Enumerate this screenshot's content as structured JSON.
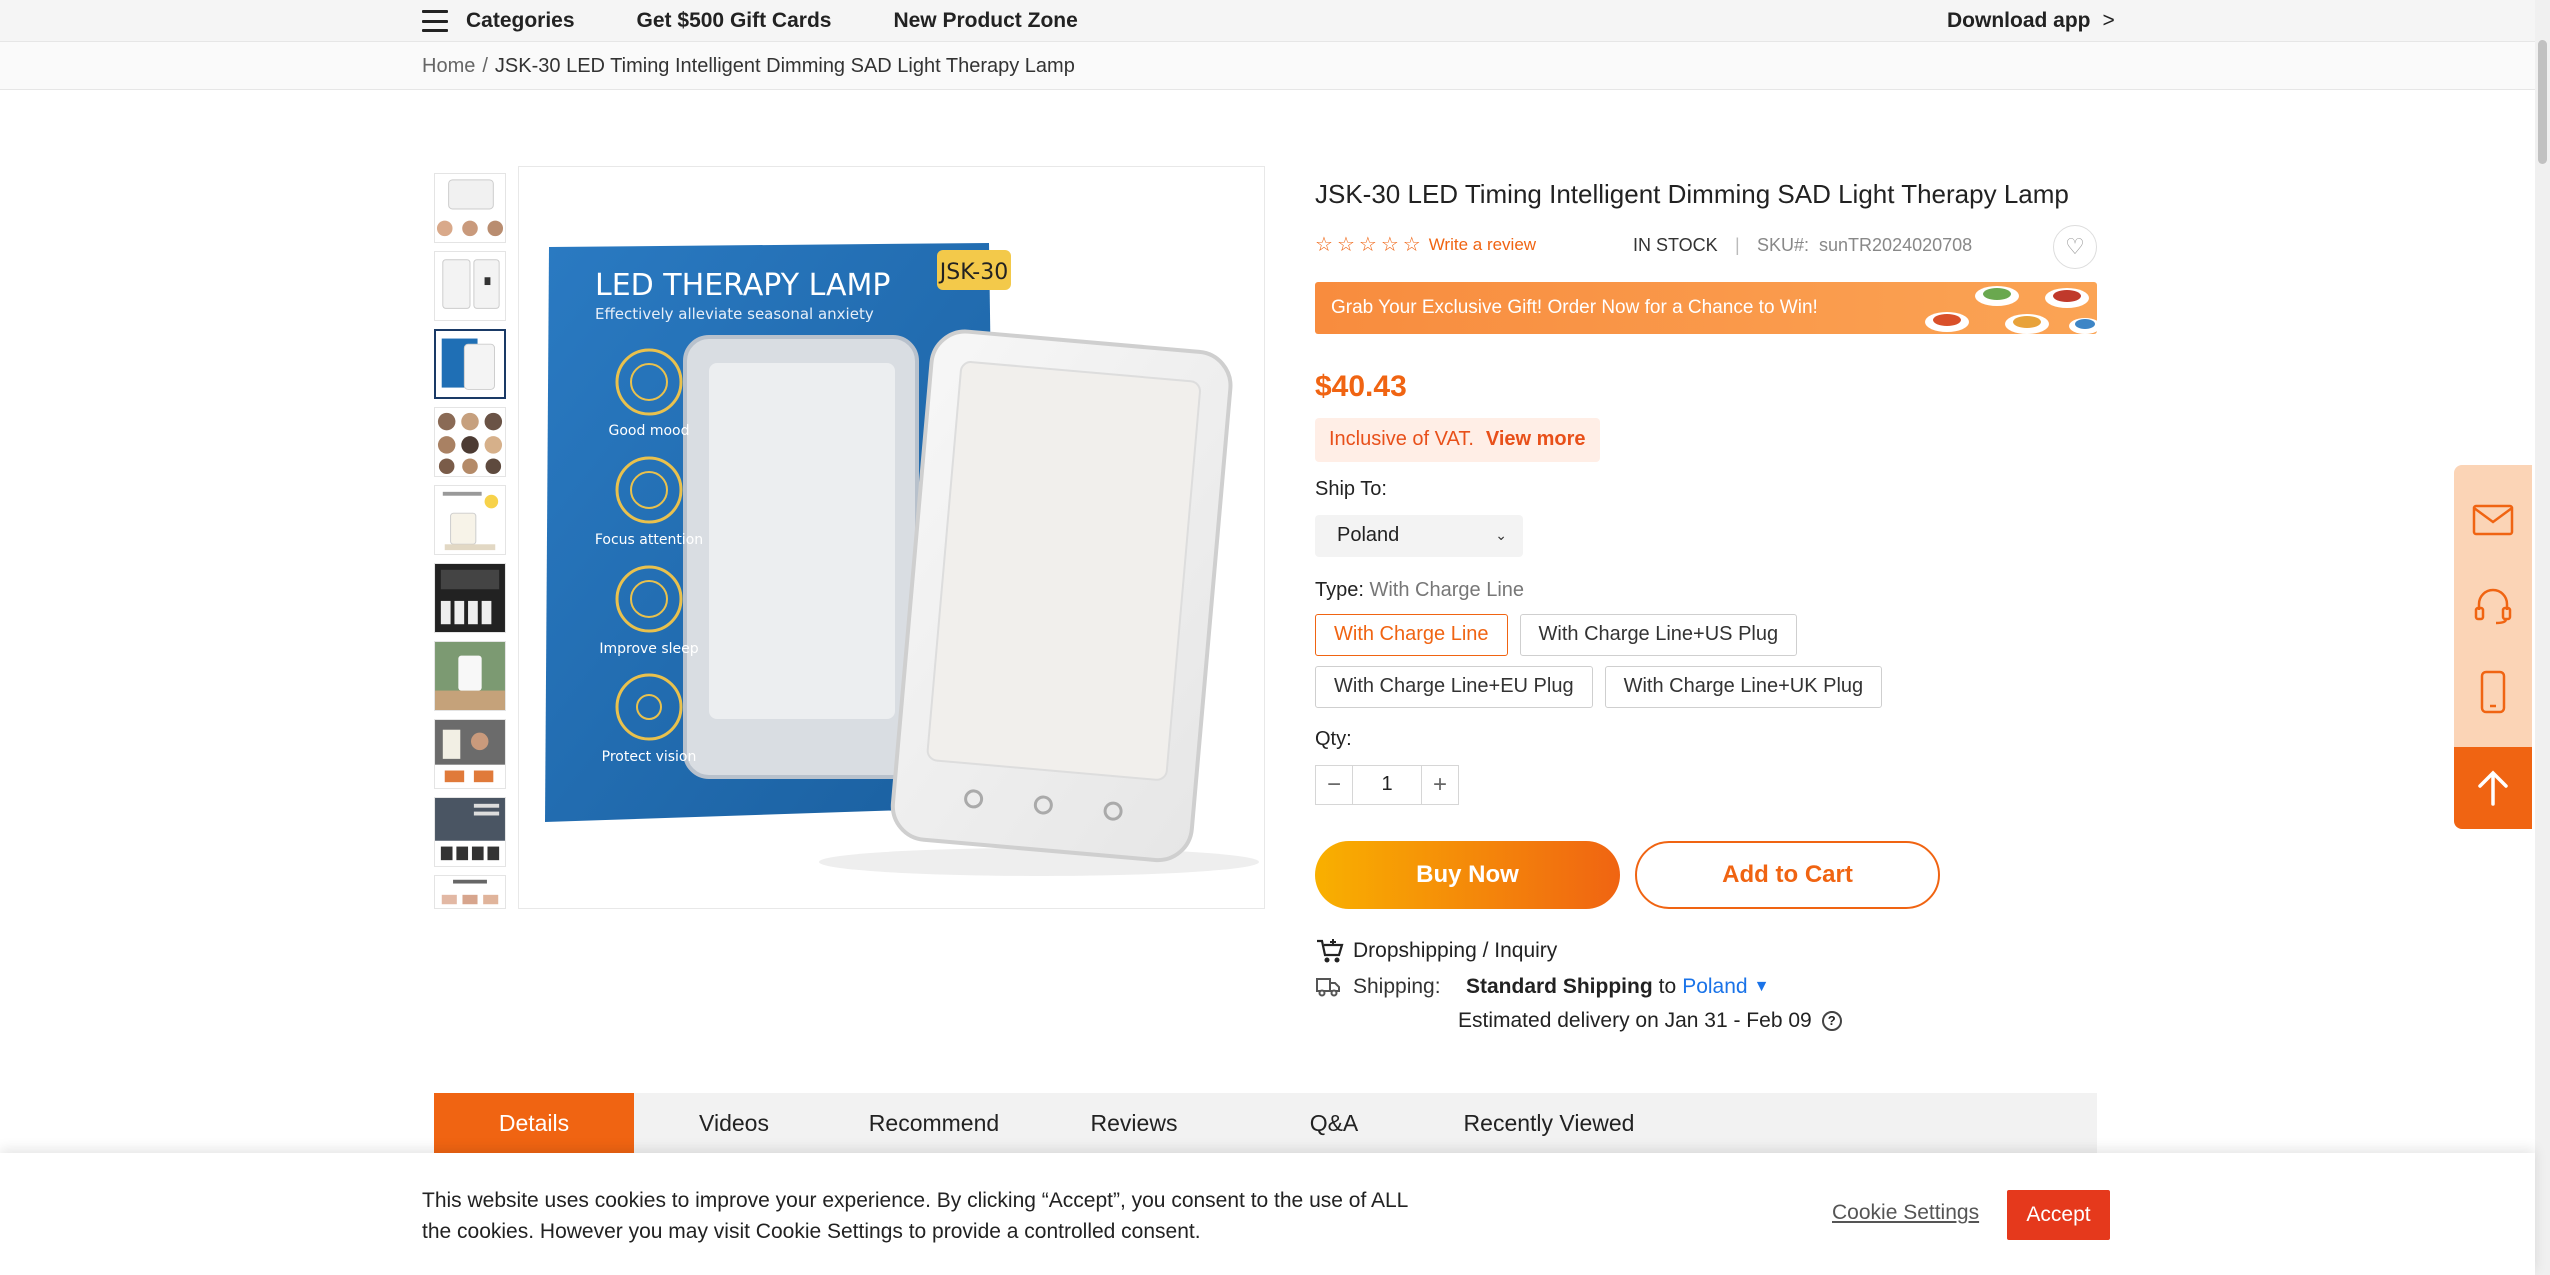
{
  "nav": {
    "categories": "Categories",
    "gift_cards": "Get $500 Gift Cards",
    "new_zone": "New Product Zone",
    "download": "Download app",
    "download_arrow": ">"
  },
  "breadcrumb": {
    "home": "Home",
    "separator": "/",
    "current": "JSK-30 LED Timing Intelligent Dimming SAD Light Therapy Lamp"
  },
  "product": {
    "title": "JSK-30 LED Timing Intelligent Dimming SAD Light Therapy Lamp",
    "rating_stars": 0,
    "write_review": "Write a review",
    "stock": "IN STOCK",
    "divider": "|",
    "sku_label": "SKU#:",
    "sku": "sunTR2024020708",
    "promo": "Grab Your Exclusive Gift! Order Now for a Chance to Win!",
    "price": "$40.43",
    "vat_label": "Inclusive of VAT.",
    "vat_more": "View more",
    "ship_to_label": "Ship To:",
    "ship_to_value": "Poland",
    "type_label": "Type:",
    "type_value": "With Charge Line",
    "options": [
      "With Charge Line",
      "With Charge Line+US Plug",
      "With Charge Line+EU Plug",
      "With Charge Line+UK Plug"
    ],
    "selected_option": 0,
    "qty_label": "Qty:",
    "qty_value": "1",
    "buy_now": "Buy Now",
    "add_to_cart": "Add to Cart",
    "dropshipping": "Dropshipping / Inquiry",
    "shipping_label": "Shipping:",
    "shipping_method": "Standard Shipping",
    "shipping_to": "to",
    "shipping_country": "Poland",
    "estimated": "Estimated delivery on Jan 31 - Feb 09"
  },
  "main_image": {
    "box_title": "LED THERAPY LAMP",
    "box_subtitle": "Effectively alleviate seasonal anxiety",
    "box_badge": "JSK-30",
    "features": [
      "Good mood",
      "Focus attention",
      "Improve sleep",
      "Protect vision"
    ]
  },
  "tabs": [
    "Details",
    "Videos",
    "Recommend",
    "Reviews",
    "Q&A",
    "Recently Viewed"
  ],
  "active_tab": 0,
  "cookie": {
    "text": "This website uses cookies to improve your experience. By clicking “Accept”, you consent to the use of ALL the cookies. However you may visit Cookie Settings to provide a controlled consent.",
    "settings": "Cookie Settings",
    "accept": "Accept"
  },
  "colors": {
    "accent": "#f06412",
    "accept_red": "#e5391c",
    "link_blue": "#1a73e8",
    "box_blue": "#1f6fb5"
  },
  "icons": {
    "menu": "hamburger-icon",
    "wishlist": "heart-icon",
    "dropship": "cart-icon",
    "shipping": "truck-icon",
    "help": "question-icon",
    "float": [
      "mail-icon",
      "headset-icon",
      "phone-icon",
      "arrow-up-icon"
    ]
  }
}
